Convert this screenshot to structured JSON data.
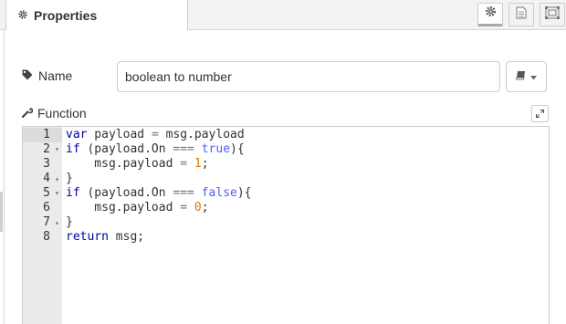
{
  "tab": {
    "title": "Properties",
    "icon": "gear-icon"
  },
  "toolbar": {
    "buttons": [
      {
        "name": "settings-icon",
        "selected": true
      },
      {
        "name": "description-icon",
        "selected": false
      },
      {
        "name": "appearance-icon",
        "selected": false
      }
    ]
  },
  "name_field": {
    "label": "Name",
    "value": "boolean to number",
    "icon": "tag-icon"
  },
  "library_button": {
    "icon": "book-icon",
    "caret": "caret-down-icon"
  },
  "function_field": {
    "label": "Function",
    "icon": "wrench-icon",
    "expand_icon": "expand-icon"
  },
  "editor": {
    "active_line": 1,
    "lines": [
      {
        "num": "1",
        "fold": "",
        "tokens": [
          {
            "t": "kw",
            "v": "var"
          },
          {
            "t": "txt",
            "v": " payload "
          },
          {
            "t": "op",
            "v": "="
          },
          {
            "t": "txt",
            "v": " msg.payload"
          }
        ]
      },
      {
        "num": "2",
        "fold": "▾",
        "tokens": [
          {
            "t": "kw",
            "v": "if"
          },
          {
            "t": "txt",
            "v": " (payload.On "
          },
          {
            "t": "op",
            "v": "==="
          },
          {
            "t": "txt",
            "v": " "
          },
          {
            "t": "bool",
            "v": "true"
          },
          {
            "t": "txt",
            "v": "){"
          }
        ]
      },
      {
        "num": "3",
        "fold": "",
        "tokens": [
          {
            "t": "txt",
            "v": "    msg.payload "
          },
          {
            "t": "op",
            "v": "="
          },
          {
            "t": "txt",
            "v": " "
          },
          {
            "t": "num",
            "v": "1"
          },
          {
            "t": "txt",
            "v": ";"
          }
        ]
      },
      {
        "num": "4",
        "fold": "▴",
        "tokens": [
          {
            "t": "txt",
            "v": "}"
          }
        ]
      },
      {
        "num": "5",
        "fold": "▾",
        "tokens": [
          {
            "t": "kw",
            "v": "if"
          },
          {
            "t": "txt",
            "v": " (payload.On "
          },
          {
            "t": "op",
            "v": "==="
          },
          {
            "t": "txt",
            "v": " "
          },
          {
            "t": "bool",
            "v": "false"
          },
          {
            "t": "txt",
            "v": "){"
          }
        ]
      },
      {
        "num": "6",
        "fold": "",
        "tokens": [
          {
            "t": "txt",
            "v": "    msg.payload "
          },
          {
            "t": "op",
            "v": "="
          },
          {
            "t": "txt",
            "v": " "
          },
          {
            "t": "num",
            "v": "0"
          },
          {
            "t": "txt",
            "v": ";"
          }
        ]
      },
      {
        "num": "7",
        "fold": "▴",
        "tokens": [
          {
            "t": "txt",
            "v": "}"
          }
        ]
      },
      {
        "num": "8",
        "fold": "",
        "tokens": [
          {
            "t": "kw",
            "v": "return"
          },
          {
            "t": "txt",
            "v": " msg;"
          }
        ]
      }
    ]
  }
}
